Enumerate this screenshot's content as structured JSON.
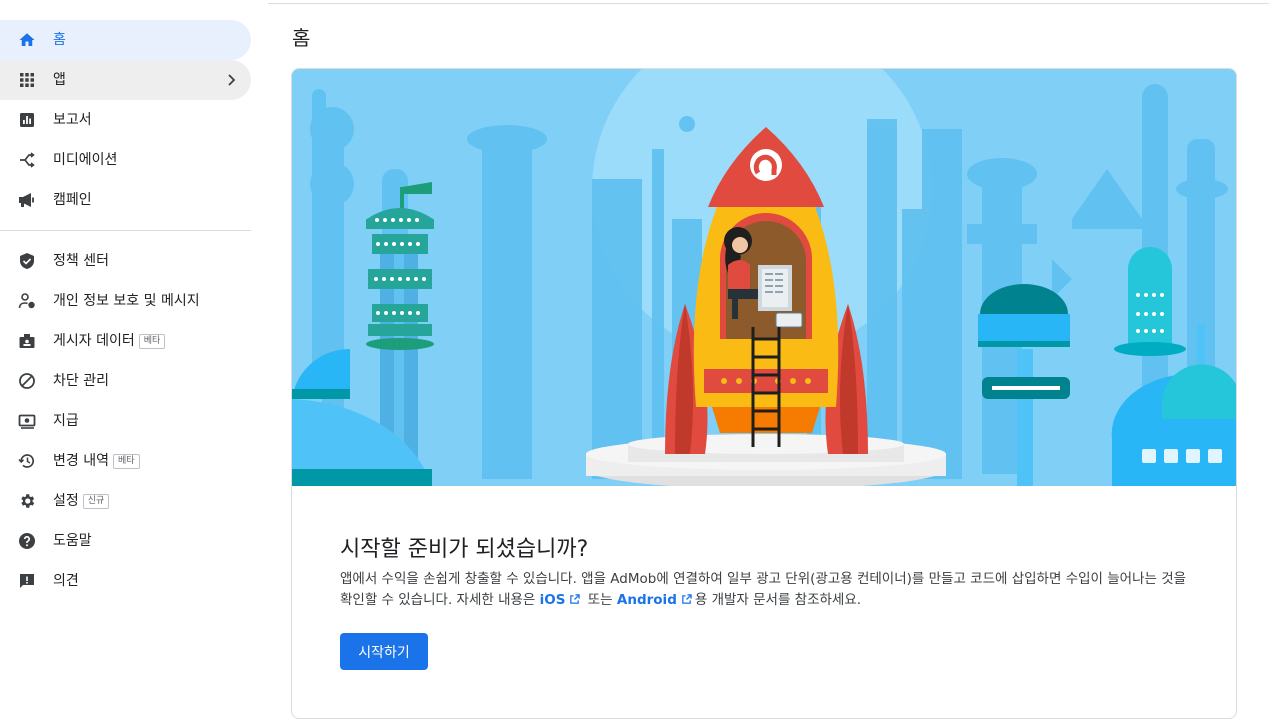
{
  "page": {
    "title": "홈"
  },
  "sidebar": {
    "items": [
      {
        "label": "홈",
        "icon": "home-icon"
      },
      {
        "label": "앱",
        "icon": "apps-grid-icon"
      },
      {
        "label": "보고서",
        "icon": "report-chart-icon"
      },
      {
        "label": "미디에이션",
        "icon": "mediation-icon"
      },
      {
        "label": "캠페인",
        "icon": "megaphone-icon"
      },
      {
        "label": "정책 센터",
        "icon": "shield-check-icon"
      },
      {
        "label": "개인 정보 보호 및 메시지",
        "icon": "privacy-person-icon"
      },
      {
        "label": "게시자 데이터",
        "icon": "publisher-data-icon",
        "badge": "베타"
      },
      {
        "label": "차단 관리",
        "icon": "block-icon"
      },
      {
        "label": "지급",
        "icon": "payments-icon"
      },
      {
        "label": "변경 내역",
        "icon": "history-icon",
        "badge": "베타"
      },
      {
        "label": "설정",
        "icon": "gear-icon",
        "badge": "신규"
      },
      {
        "label": "도움말",
        "icon": "help-icon"
      },
      {
        "label": "의견",
        "icon": "feedback-icon"
      }
    ]
  },
  "card": {
    "title": "시작할 준비가 되셨습니까?",
    "body_1": "앱에서 수익을 손쉽게 창출할 수 있습니다. 앱을 AdMob에 연결하여 일부 광고 단위(광고용 컨테이너)를 만들고 코드에 삽입하면 수입이 늘어나는 것을 확인할 수 있습니다. 자세한 내용은 ",
    "link_ios": "iOS",
    "body_2": " 또는 ",
    "link_android": "Android",
    "body_3": "용 개발자 문서를 참조하세요.",
    "cta": "시작하기"
  },
  "colors": {
    "accent": "#1a73e8",
    "active_nav_bg": "#e8f0fe",
    "hero_sky": "#7fcff7",
    "rocket_red": "#e04a3f",
    "rocket_yellow": "#f9bb14"
  }
}
